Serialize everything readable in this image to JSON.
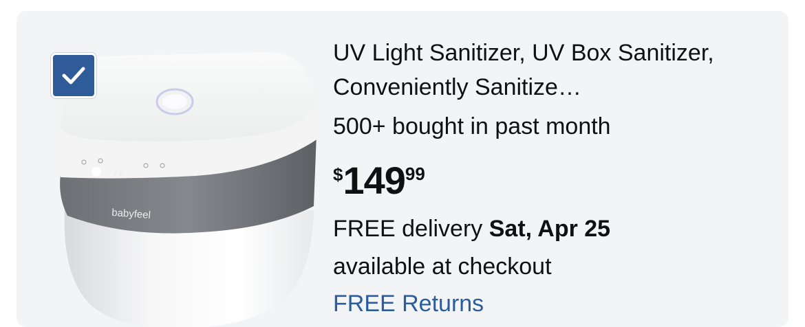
{
  "product": {
    "title": "UV Light Sanitizer, UV Box Sanitizer, Conveniently Sanitize…",
    "bought_text": "500+ bought in past month",
    "price": {
      "symbol": "$",
      "whole": "149",
      "fraction": "99"
    },
    "delivery": {
      "prefix": "FREE delivery ",
      "date": "Sat, Apr 25"
    },
    "availability": "available at checkout",
    "returns": "FREE Returns",
    "image": {
      "brand_text": "babyfeel",
      "display_text": "/ /"
    },
    "selected": true
  },
  "colors": {
    "card_background": "#f3f4f6",
    "checkbox": "#2f5b99",
    "link": "#2a5d9a",
    "text": "#0f1111"
  },
  "icons": {
    "checkbox": "checkmark-icon"
  }
}
